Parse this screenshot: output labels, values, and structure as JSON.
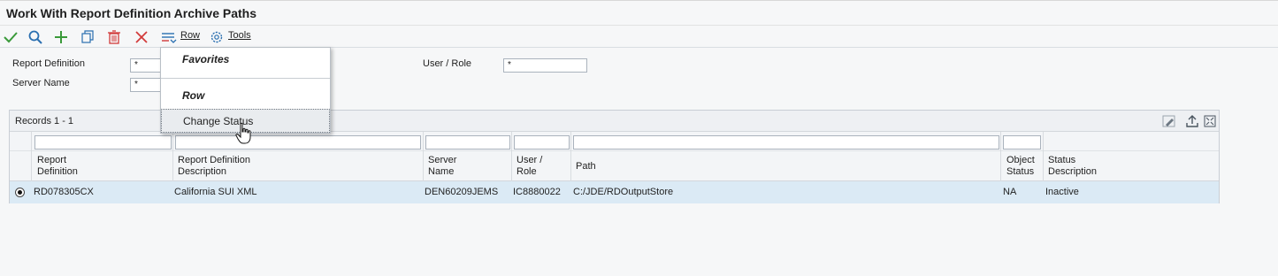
{
  "title": "Work With Report Definition Archive Paths",
  "toolbar": {
    "icons": [
      "checkmark-icon",
      "search-icon",
      "plus-icon",
      "copy-icon",
      "trash-icon",
      "close-icon"
    ],
    "row_label": "Row",
    "tools_label": "Tools"
  },
  "form": {
    "report_definition_label": "Report Definition",
    "report_definition_value": "*",
    "server_name_label": "Server Name",
    "server_name_value": "*",
    "user_role_label": "User / Role",
    "user_role_value": "*"
  },
  "grid": {
    "records_label": "Records 1 - 1",
    "columns": [
      {
        "line1": "Report",
        "line2": "Definition"
      },
      {
        "line1": "Report Definition",
        "line2": "Description"
      },
      {
        "line1": "Server",
        "line2": "Name"
      },
      {
        "line1": "User /",
        "line2": "Role"
      },
      {
        "line1": "Path",
        "line2": ""
      },
      {
        "line1": "Object",
        "line2": "Status"
      },
      {
        "line1": "Status",
        "line2": "Description"
      }
    ],
    "rows": [
      {
        "report_definition": "RD078305CX",
        "description": "California SUI XML",
        "server_name": "DEN60209JEMS",
        "user_role": "IC8880022",
        "path": "C:/JDE/RDOutputStore",
        "object_status": "NA",
        "status_description": "Inactive"
      }
    ]
  },
  "row_menu": {
    "favorites": "Favorites",
    "row": "Row",
    "change_status": "Change Status"
  },
  "colors": {
    "accent_green": "#3a9a3a",
    "accent_blue": "#2a6fb0",
    "accent_red": "#d23a3a",
    "selected_row": "#dbeaf5"
  }
}
